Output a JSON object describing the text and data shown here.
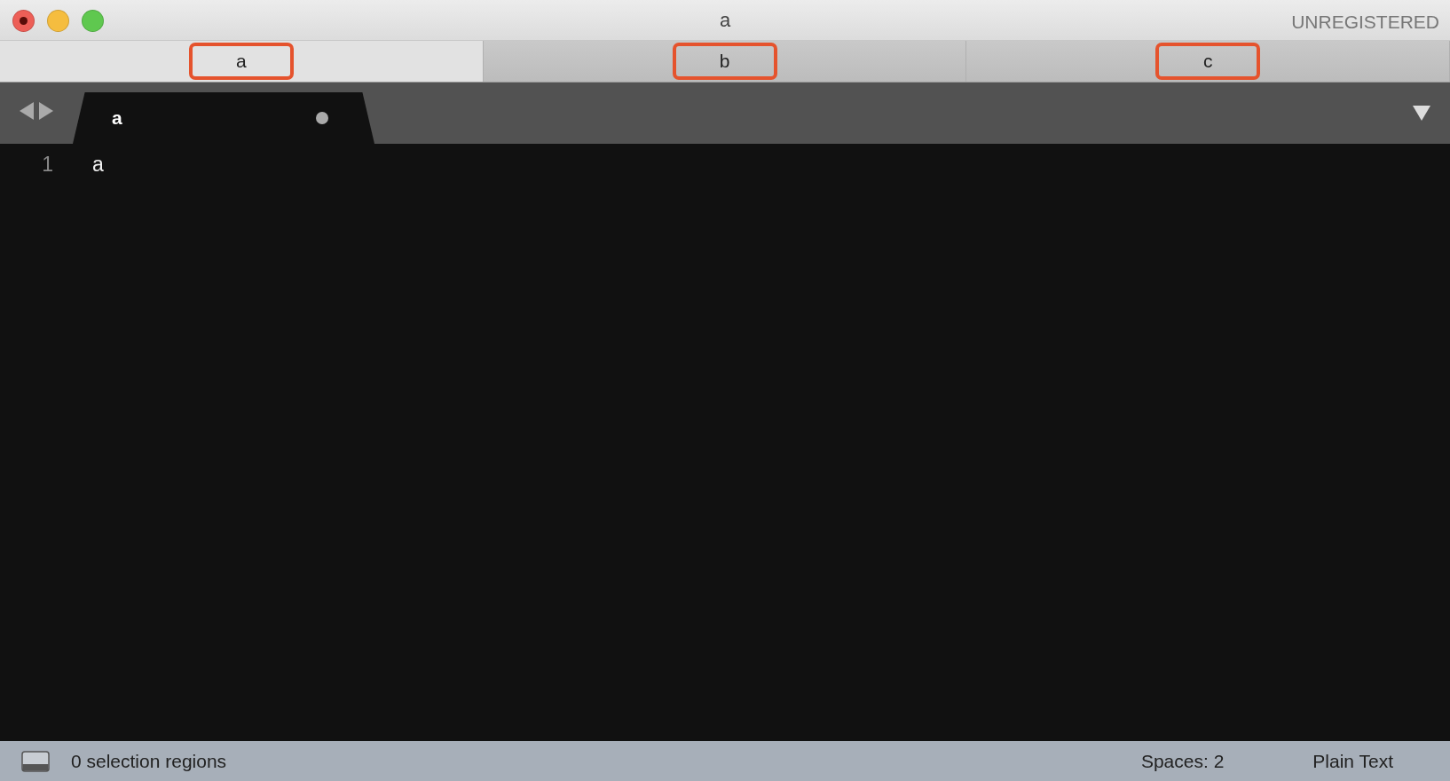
{
  "window": {
    "title": "a",
    "registration": "UNREGISTERED"
  },
  "window_tabs": [
    {
      "label": "a",
      "selected": true,
      "highlighted": true
    },
    {
      "label": "b",
      "selected": false,
      "highlighted": true
    },
    {
      "label": "c",
      "selected": false,
      "highlighted": true
    }
  ],
  "editor_tabs": [
    {
      "label": "a",
      "selected": true,
      "modified": true
    }
  ],
  "lines": [
    {
      "number": "1",
      "text": "a"
    }
  ],
  "status_bar": {
    "selection": "0 selection regions",
    "indentation": "Spaces: 2",
    "syntax": "Plain Text"
  }
}
